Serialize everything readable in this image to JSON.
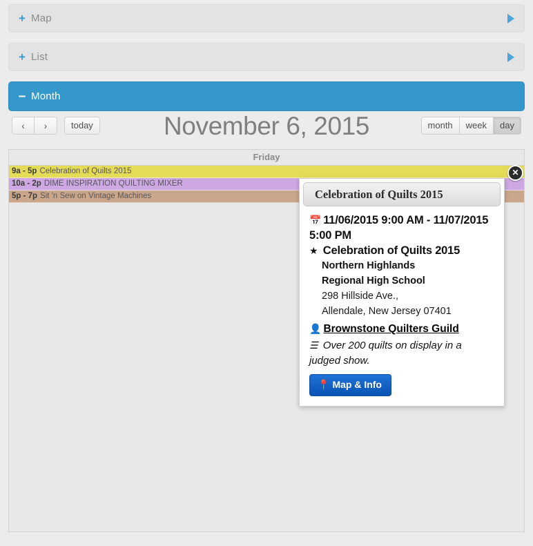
{
  "accordion": {
    "panels": [
      {
        "label": "Map",
        "sign": "+",
        "state": "collapsed",
        "arrow": "chevron-right-icon"
      },
      {
        "label": "List",
        "sign": "+",
        "state": "collapsed",
        "arrow": "chevron-right-icon"
      },
      {
        "label": "Month",
        "sign": "–",
        "state": "expanded"
      }
    ]
  },
  "toolbar": {
    "prev_label": "‹",
    "next_label": "›",
    "today_label": "today",
    "views": [
      {
        "label": "month",
        "active": false
      },
      {
        "label": "week",
        "active": false
      },
      {
        "label": "day",
        "active": true
      }
    ]
  },
  "calendar": {
    "title": "November 6, 2015",
    "day_header": "Friday",
    "events": [
      {
        "time": "9a - 5p",
        "title": "Celebration of Quilts 2015",
        "color": "#e4dc57"
      },
      {
        "time": "10a - 2p",
        "title": "DIME INSPIRATION QUILTING MIXER",
        "color": "#cda8e3"
      },
      {
        "time": "5p - 7p",
        "title": "Sit 'n Sew on Vintage Machines",
        "color": "#caa68a"
      }
    ]
  },
  "popup": {
    "header": "Celebration of Quilts 2015",
    "date_icon": "calendar-icon",
    "date_range": "11/06/2015 9:00 AM - 11/07/2015 5:00 PM",
    "star_icon": "star-icon",
    "event_name": "Celebration of Quilts 2015",
    "venue_line1": "Northern Highlands",
    "venue_line2": "Regional High School",
    "address_line1": "298 Hillside Ave.,",
    "address_line2": "Allendale, New Jersey 07401",
    "person_icon": "person-icon",
    "organizer": "Brownstone Quilters Guild",
    "description_icon": "list-icon",
    "description": "Over 200 quilts on display in a judged show.",
    "map_button_label": "Map & Info",
    "map_button_icon": "location-pin-icon",
    "close_label": "✕",
    "accent_color": "#0a52b5"
  }
}
